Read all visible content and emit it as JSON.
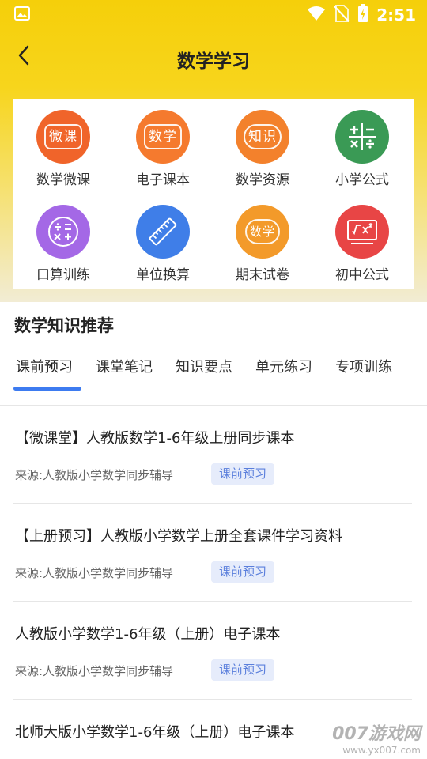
{
  "status_bar": {
    "time": "2:51",
    "icons": [
      "image-icon",
      "wifi-icon",
      "no-sim-icon",
      "battery-charging-icon"
    ]
  },
  "nav": {
    "title": "数学学习",
    "back_icon": "chevron-left-icon"
  },
  "grid": [
    {
      "label": "数学微课",
      "icon_text": "微课",
      "color": "#f0642a"
    },
    {
      "label": "电子课本",
      "icon_text": "数学",
      "color": "#f57a2e"
    },
    {
      "label": "数学资源",
      "icon_text": "知识",
      "color": "#f3812c"
    },
    {
      "label": "小学公式",
      "icon": "math-symbols-icon",
      "color": "#3a9a55"
    },
    {
      "label": "口算训练",
      "icon": "calculator-symbols-icon",
      "color": "#a468e6"
    },
    {
      "label": "单位换算",
      "icon": "ruler-icon",
      "color": "#3f7ee8"
    },
    {
      "label": "期末试卷",
      "icon_text": "数学",
      "color": "#f39a2a"
    },
    {
      "label": "初中公式",
      "icon": "formula-board-icon",
      "color": "#e84545"
    }
  ],
  "section": {
    "title": "数学知识推荐"
  },
  "tabs": [
    "课前预习",
    "课堂笔记",
    "知识要点",
    "单元练习",
    "专项训练"
  ],
  "active_tab": "课前预习",
  "accent_color": "#3d7bf0",
  "articles": [
    {
      "title": "【微课堂】人教版数学1-6年级上册同步课本",
      "source": "来源:人教版小学数学同步辅导",
      "tag": "课前预习"
    },
    {
      "title": "【上册预习】人教版小学数学上册全套课件学习资料",
      "source": "来源:人教版小学数学同步辅导",
      "tag": "课前预习"
    },
    {
      "title": "人教版小学数学1-6年级（上册）电子课本",
      "source": "来源:人教版小学数学同步辅导",
      "tag": "课前预习"
    },
    {
      "title": "北师大版小学数学1-6年级（上册）电子课本",
      "source": "",
      "tag": ""
    }
  ],
  "watermark": {
    "main": "007游戏网",
    "url": "www.yx007.com"
  }
}
